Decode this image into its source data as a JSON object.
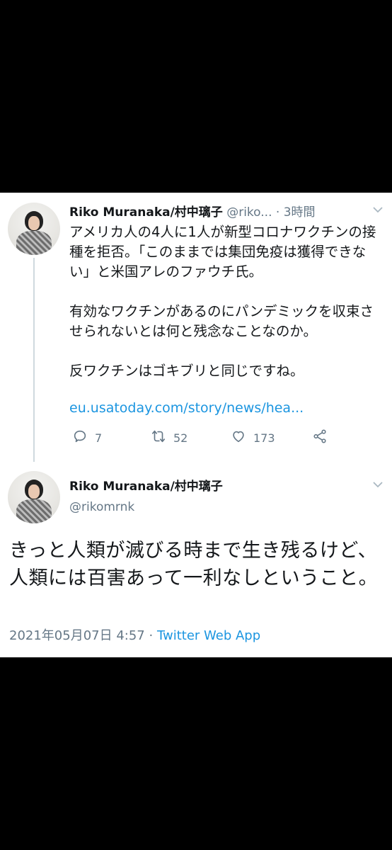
{
  "tweet1": {
    "author_name": "Riko Muranaka/村中璃子",
    "author_handle": "@riko...",
    "separator": "·",
    "time": "3時間",
    "paragraphs": [
      "アメリカ人の4人に1人が新型コロナワクチンの接種を拒否。「このままでは集団免疫は獲得できない」と米国アレのファウチ氏。",
      "有効なワクチンがあるのにパンデミックを収束させられないとは何と残念なことなのか。",
      "反ワクチンはゴキブリと同じですね。"
    ],
    "link": "eu.usatoday.com/story/news/hea...",
    "actions": {
      "reply_count": "7",
      "retweet_count": "52",
      "like_count": "173"
    }
  },
  "tweet2": {
    "author_name": "Riko Muranaka/村中璃子",
    "author_handle": "@rikomrnk",
    "text": "きっと人類が滅びる時まで生き残るけど、人類には百害あって一利なしということ。",
    "date": "2021年05月07日 4:57",
    "separator": "·",
    "source": "Twitter Web App"
  },
  "icons": {
    "reply": "reply-icon",
    "retweet": "retweet-icon",
    "like": "heart-icon",
    "share": "share-icon",
    "menu": "chevron-down-icon"
  },
  "colors": {
    "link": "#1b95e0",
    "muted": "#657786",
    "text": "#14171a",
    "background": "#000000",
    "card": "#ffffff"
  }
}
